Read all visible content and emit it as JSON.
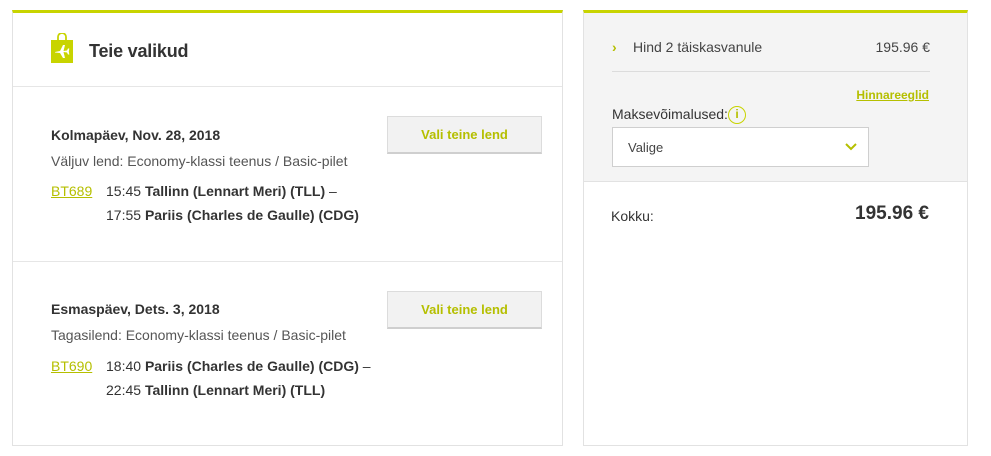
{
  "left": {
    "title": "Teie valikud",
    "flights": [
      {
        "date": "Kolmapäev, Nov. 28, 2018",
        "type": "Väljuv lend: Economy-klassi teenus / Basic-pilet",
        "code": "BT689",
        "dep_time": "15:45",
        "dep_place": "Tallinn (Lennart Meri) (TLL)",
        "arr_time": "17:55",
        "arr_place": "Pariis (Charles de Gaulle) (CDG)",
        "button": "Vali teine lend"
      },
      {
        "date": "Esmaspäev, Dets. 3, 2018",
        "type": "Tagasilend: Economy-klassi teenus / Basic-pilet",
        "code": "BT690",
        "dep_time": "18:40",
        "dep_place": "Pariis (Charles de Gaulle) (CDG)",
        "arr_time": "22:45",
        "arr_place": "Tallinn (Lennart Meri) (TLL)",
        "button": "Vali teine lend"
      }
    ]
  },
  "right": {
    "price_label": "Hind 2 täiskasvanule",
    "price_value": "195.96 €",
    "rules_link": "Hinnareeglid",
    "payment_label": "Maksevõimalused:",
    "payment_select": "Valige",
    "total_label": "Kokku:",
    "total_value": "195.96 €"
  },
  "colors": {
    "accent": "#c8d400",
    "accent_text": "#b5bf00"
  },
  "icons": {
    "bag": "shopping-bag-plane-icon",
    "info": "info-icon",
    "chevron_right": "chevron-right-icon",
    "chevron_down": "chevron-down-icon"
  }
}
